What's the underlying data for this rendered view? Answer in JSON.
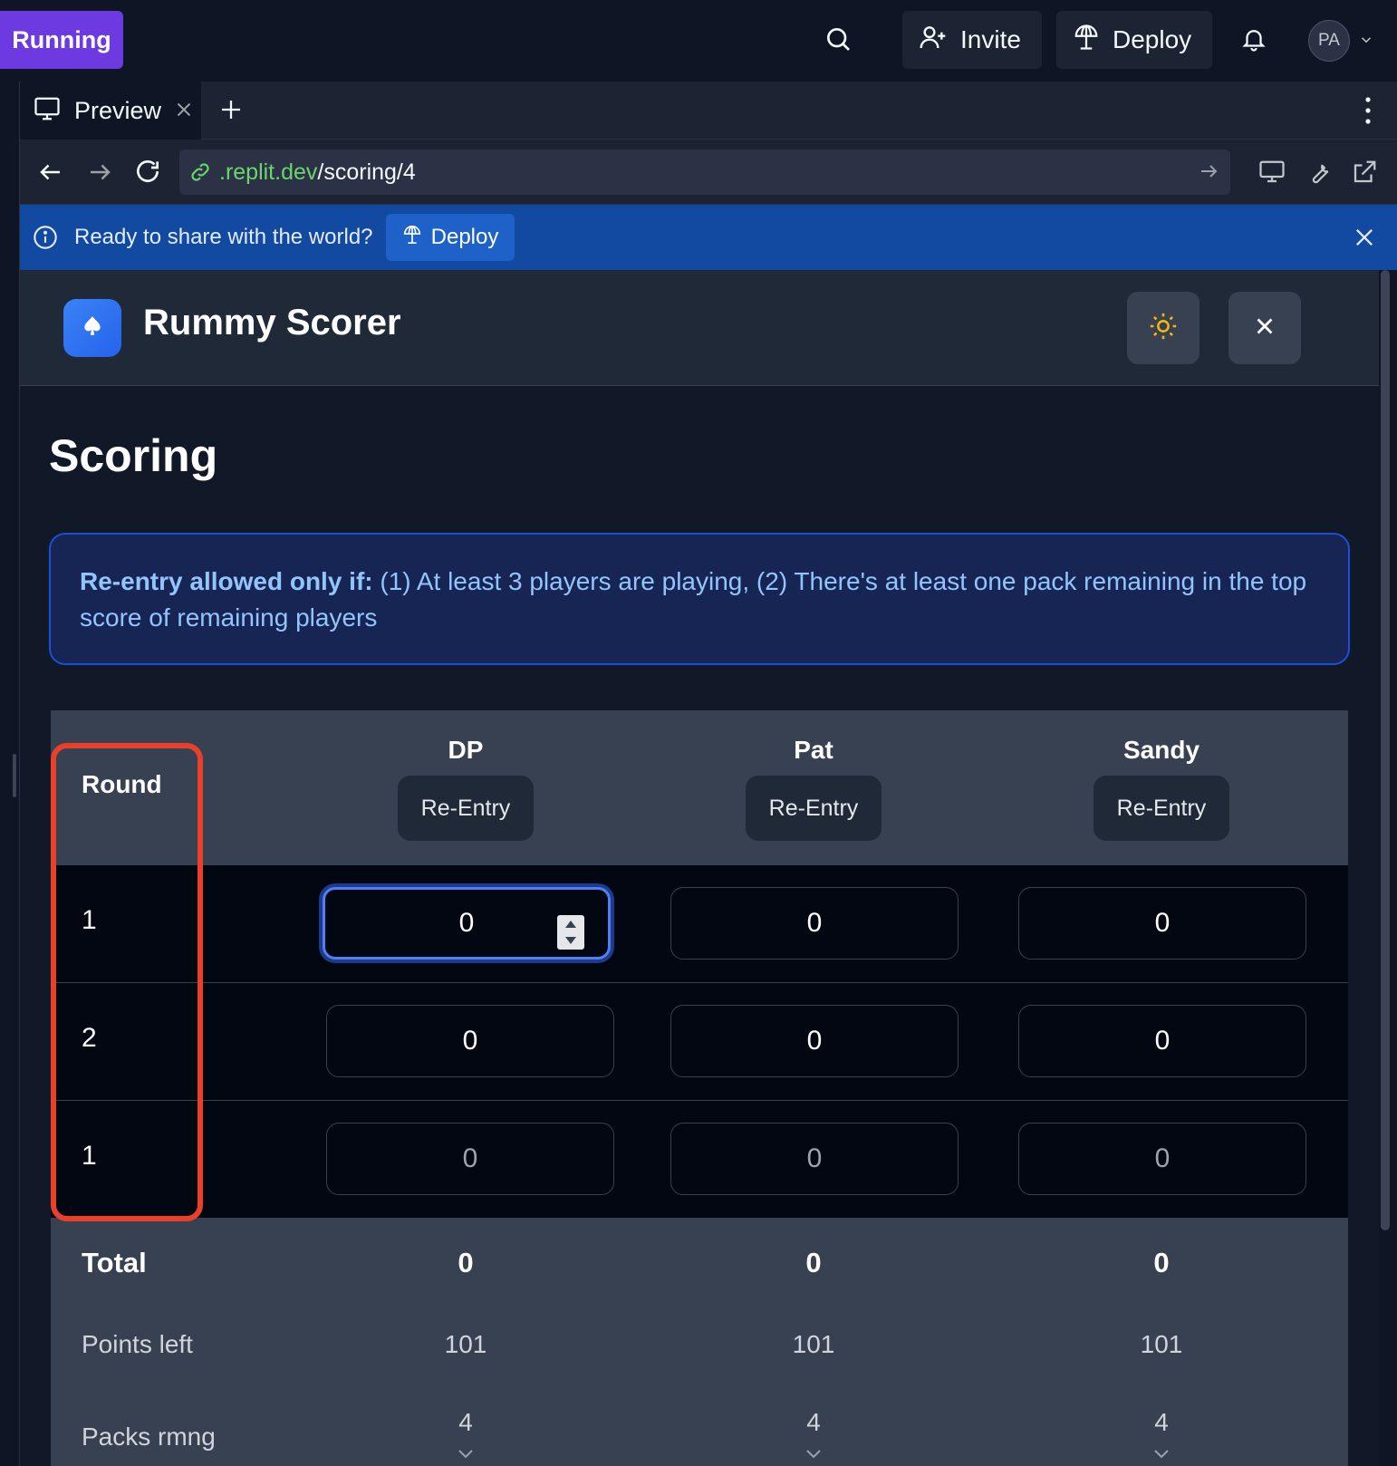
{
  "topbar": {
    "run_status": "Running",
    "invite_label": "Invite",
    "deploy_label": "Deploy",
    "avatar_initials": "PA"
  },
  "tabs": [
    {
      "label": "Preview"
    }
  ],
  "url": {
    "host": ".replit.dev",
    "path": "/scoring/4"
  },
  "banner": {
    "text": "Ready to share with the world?",
    "button_label": "Deploy"
  },
  "app": {
    "title": "Rummy Scorer",
    "page_title": "Scoring",
    "info_bold": "Re-entry allowed only if:",
    "info_text": " (1) At least 3 players are playing, (2) There's at least one pack remaining in the top score of remaining players"
  },
  "table": {
    "round_header": "Round",
    "reentry_label": "Re-Entry",
    "players": [
      "DP",
      "Pat",
      "Sandy"
    ],
    "rows": [
      {
        "round": "1",
        "scores": [
          "0",
          "0",
          "0"
        ]
      },
      {
        "round": "2",
        "scores": [
          "0",
          "0",
          "0"
        ]
      },
      {
        "round": "1",
        "scores": [
          "0",
          "0",
          "0"
        ]
      }
    ],
    "total_label": "Total",
    "totals": [
      "0",
      "0",
      "0"
    ],
    "points_left_label": "Points left",
    "points_left": [
      "101",
      "101",
      "101"
    ],
    "packs_label": "Packs rmng",
    "packs": [
      "4",
      "4",
      "4"
    ]
  },
  "colors": {
    "running": "#6c3ae0",
    "banner": "#134aa1",
    "highlight": "#e8402a",
    "focus": "#4f7ff0"
  }
}
